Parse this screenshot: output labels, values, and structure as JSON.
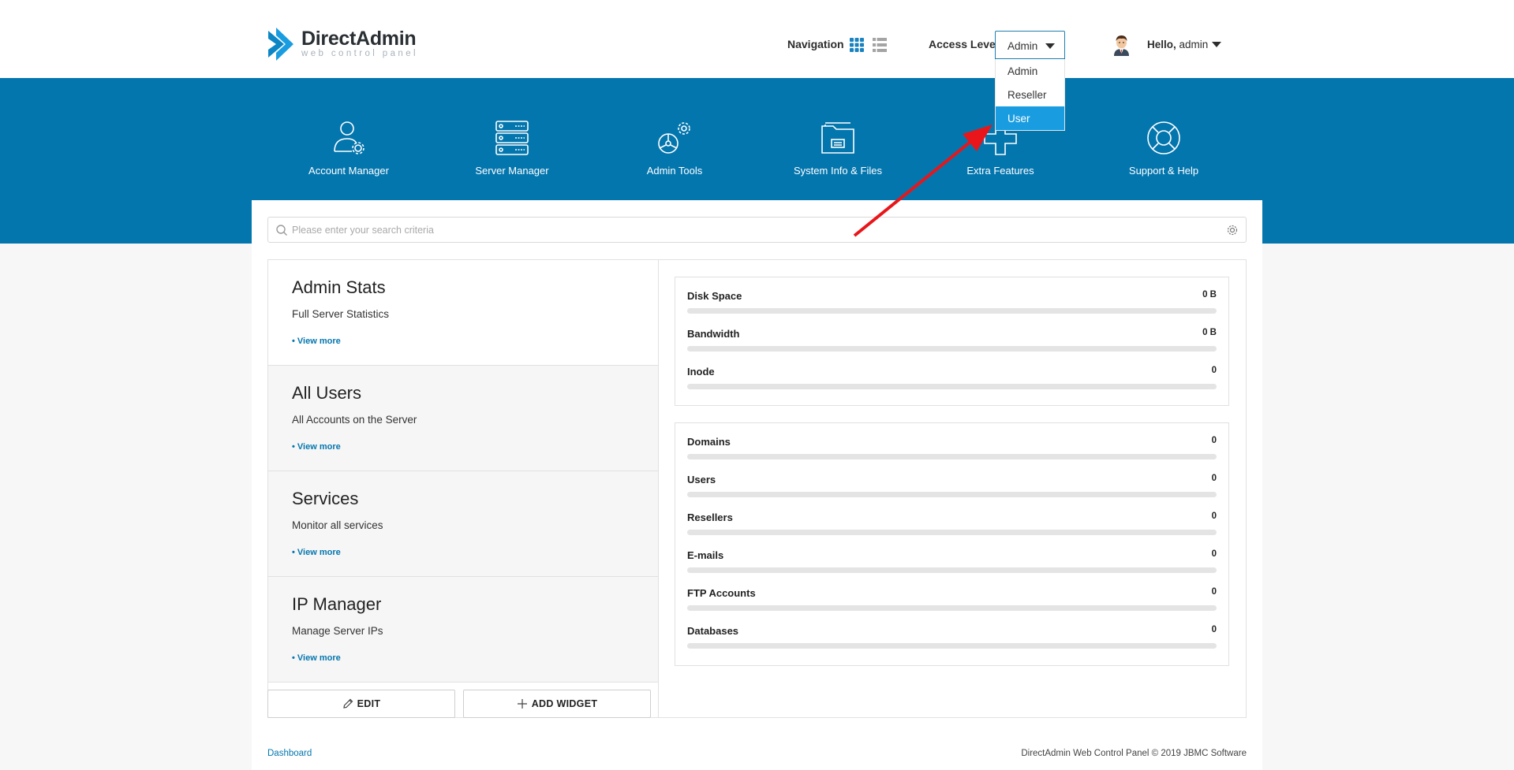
{
  "brand": {
    "name": "DirectAdmin",
    "tagline": "web control panel",
    "colors": {
      "primary": "#0476ae",
      "highlight": "#1a9de0"
    }
  },
  "header": {
    "navigation_label": "Navigation",
    "access_level_label": "Access Level",
    "access_level_value": "Admin",
    "access_options": [
      "Admin",
      "Reseller",
      "User"
    ],
    "access_highlighted": "User",
    "greeting": "Hello,",
    "username": "admin"
  },
  "menu": [
    {
      "label": "Account Manager",
      "icon": "account-manager-icon"
    },
    {
      "label": "Server Manager",
      "icon": "server-manager-icon"
    },
    {
      "label": "Admin Tools",
      "icon": "admin-tools-icon"
    },
    {
      "label": "System Info & Files",
      "icon": "system-info-files-icon"
    },
    {
      "label": "Extra Features",
      "icon": "extra-features-icon"
    },
    {
      "label": "Support & Help",
      "icon": "support-help-icon"
    }
  ],
  "search": {
    "placeholder": "Please enter your search criteria"
  },
  "widgets": [
    {
      "title": "Admin Stats",
      "subtitle": "Full Server Statistics",
      "link": "• View more"
    },
    {
      "title": "All Users",
      "subtitle": "All Accounts on the Server",
      "link": "• View more"
    },
    {
      "title": "Services",
      "subtitle": "Monitor all services",
      "link": "• View more"
    },
    {
      "title": "IP Manager",
      "subtitle": "Manage Server IPs",
      "link": "• View more"
    }
  ],
  "buttons": {
    "edit": "EDIT",
    "add_widget": "ADD WIDGET"
  },
  "usage_stats": [
    {
      "name": "Disk Space",
      "value": "0 B",
      "fraction": 0
    },
    {
      "name": "Bandwidth",
      "value": "0 B",
      "fraction": 0
    },
    {
      "name": "Inode",
      "value": "0",
      "fraction": 0
    }
  ],
  "count_stats": [
    {
      "name": "Domains",
      "value": "0",
      "fraction": 0
    },
    {
      "name": "Users",
      "value": "0",
      "fraction": 0
    },
    {
      "name": "Resellers",
      "value": "0",
      "fraction": 0
    },
    {
      "name": "E-mails",
      "value": "0",
      "fraction": 0
    },
    {
      "name": "FTP Accounts",
      "value": "0",
      "fraction": 0
    },
    {
      "name": "Databases",
      "value": "0",
      "fraction": 0
    }
  ],
  "footer": {
    "breadcrumb": "Dashboard",
    "copyright": "DirectAdmin Web Control Panel © 2019 JBMC Software"
  },
  "annotation": {
    "arrow_color": "#e8161a"
  }
}
